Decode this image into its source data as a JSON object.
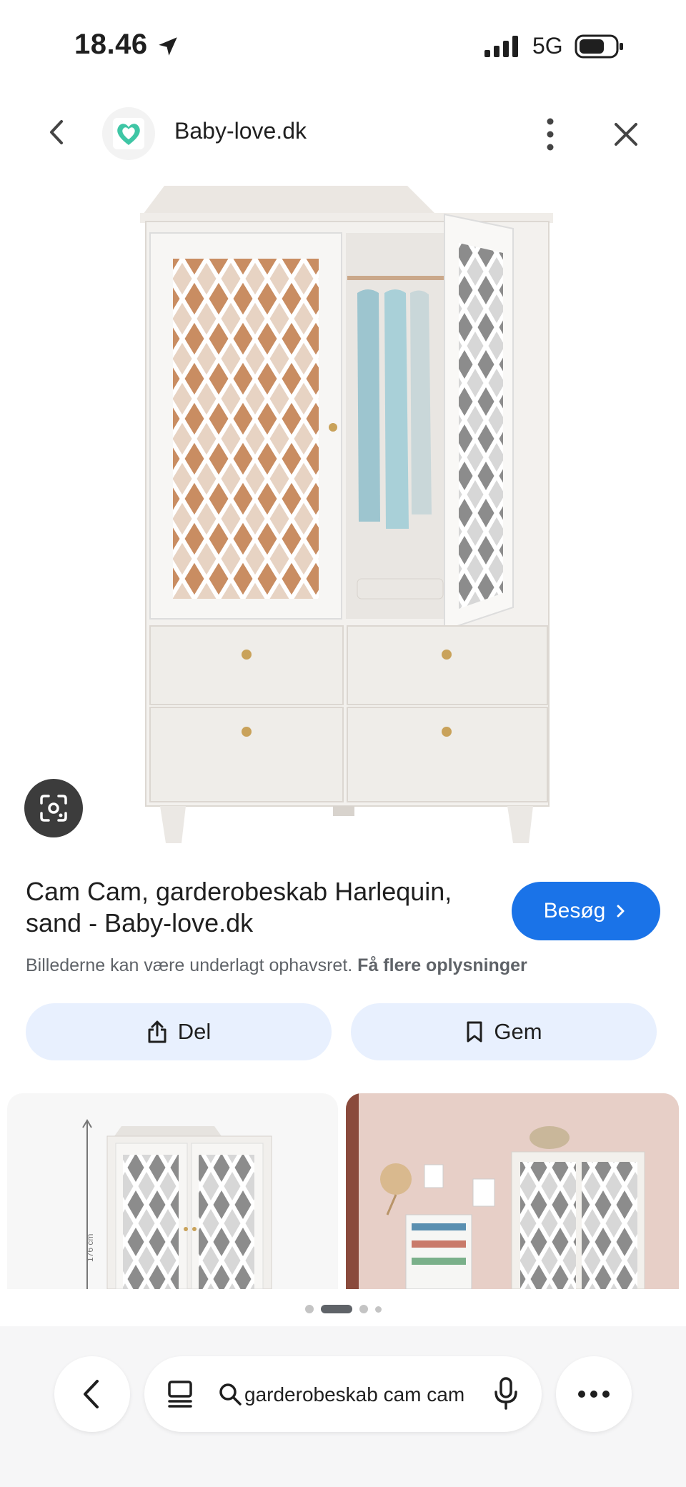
{
  "status_bar": {
    "time": "18.46",
    "network": "5G"
  },
  "header": {
    "site_name": "Baby-love.dk"
  },
  "result": {
    "title": "Cam Cam, garderobeskab Harlequin, sand - Baby-love.dk",
    "visit_label": "Besøg",
    "copyright_text": "Billederne kan være underlagt ophavsret.",
    "copyright_link": "Få flere oplysninger"
  },
  "actions": {
    "share_label": "Del",
    "save_label": "Gem"
  },
  "related": [
    {
      "dimension_label": "176 cm"
    },
    {
      "shelf_label": ""
    }
  ],
  "search": {
    "query": "garderobeskab cam cam"
  },
  "colors": {
    "accent": "#1a73e8",
    "action_bg": "#e8f0fe",
    "logo_green": "#3fc6a5"
  },
  "icons": [
    "back-icon",
    "heart-logo-icon",
    "more-vert-icon",
    "close-icon",
    "lens-icon",
    "chevron-right-icon",
    "share-icon",
    "bookmark-icon",
    "chevron-left-icon",
    "tabs-icon",
    "search-icon",
    "mic-icon",
    "more-horiz-icon"
  ]
}
